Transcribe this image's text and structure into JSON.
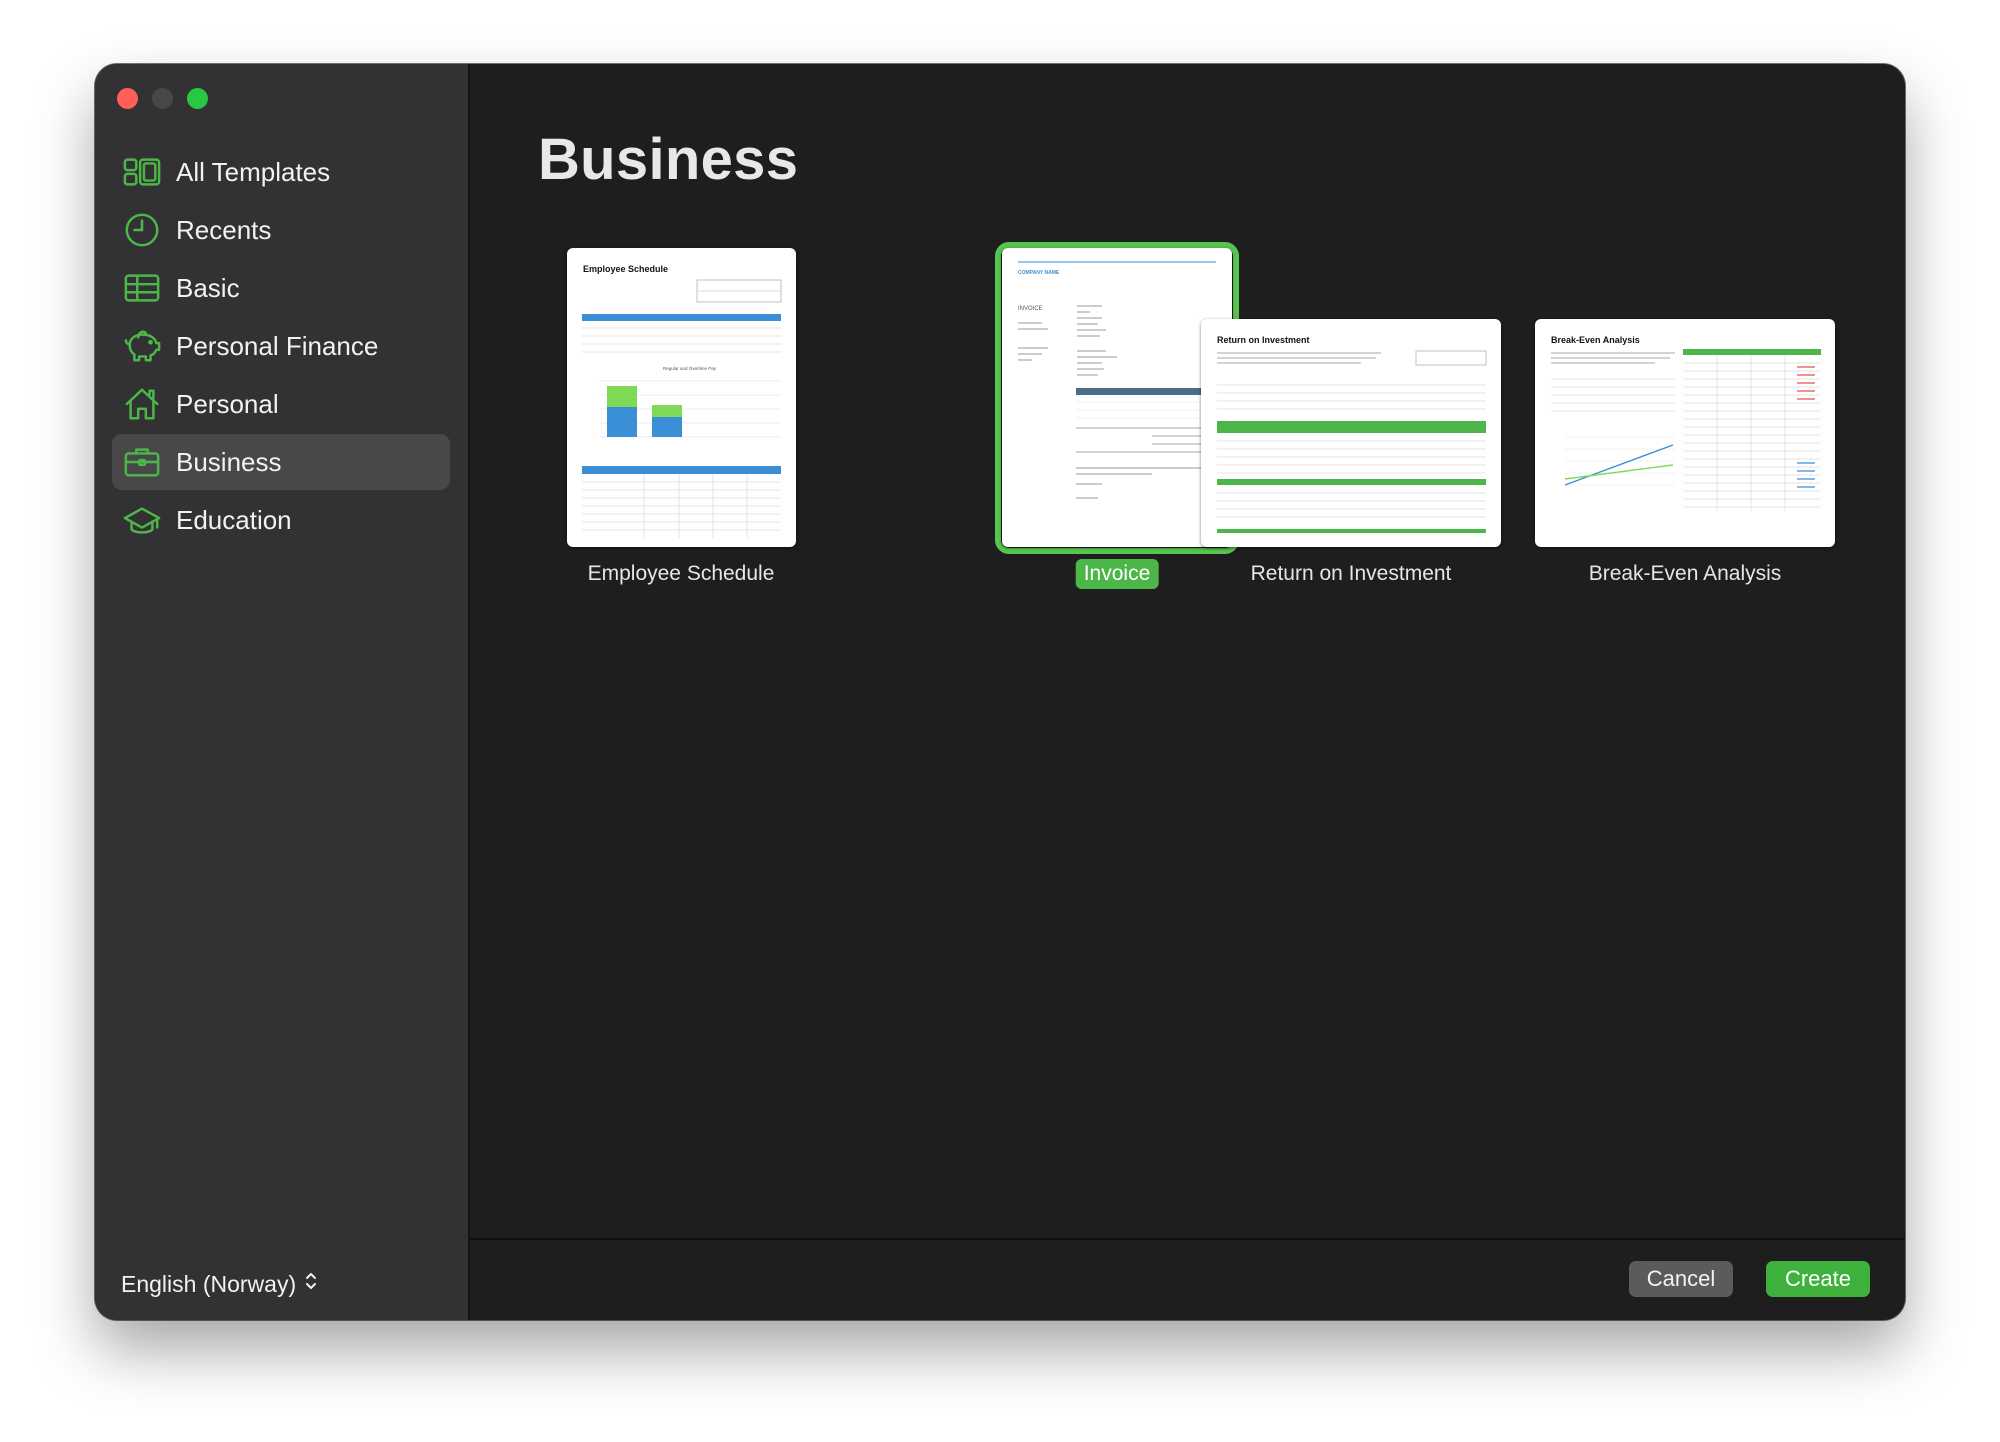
{
  "sidebar": {
    "items": [
      {
        "label": "All Templates",
        "icon": "grid-icon"
      },
      {
        "label": "Recents",
        "icon": "clock-icon"
      },
      {
        "label": "Basic",
        "icon": "table-icon"
      },
      {
        "label": "Personal Finance",
        "icon": "piggy-bank-icon"
      },
      {
        "label": "Personal",
        "icon": "house-icon"
      },
      {
        "label": "Business",
        "icon": "briefcase-icon",
        "active": true
      },
      {
        "label": "Education",
        "icon": "graduation-cap-icon"
      }
    ],
    "language": "English (Norway)"
  },
  "main": {
    "title": "Business",
    "templates": [
      {
        "label": "Employee Schedule",
        "selected": false
      },
      {
        "label": "Invoice",
        "selected": true
      },
      {
        "label": "Return on Investment",
        "selected": false
      },
      {
        "label": "Break-Even Analysis",
        "selected": false
      }
    ],
    "thumbnails": {
      "employee_schedule": {
        "heading": "Employee Schedule"
      },
      "invoice": {
        "company": "COMPANY NAME",
        "doc": "INVOICE"
      },
      "roi": {
        "heading": "Return on Investment"
      },
      "break_even": {
        "heading": "Break-Even Analysis"
      }
    }
  },
  "footer": {
    "cancel": "Cancel",
    "create": "Create"
  },
  "colors": {
    "accent": "#4cb748",
    "sidebar_bg": "#323234",
    "main_bg": "#1e1e1e",
    "table_blue": "#3b8fd6"
  }
}
